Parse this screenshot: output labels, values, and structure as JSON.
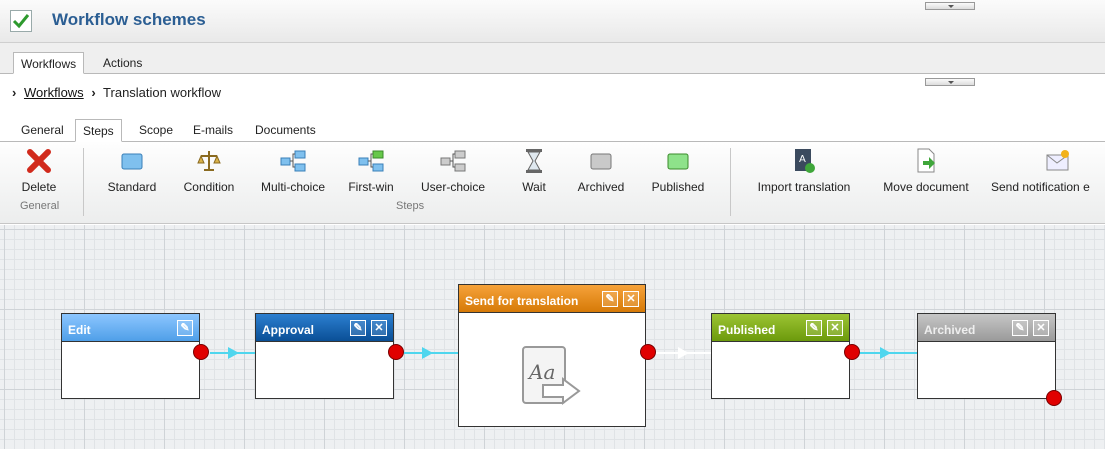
{
  "header": {
    "title": "Workflow schemes"
  },
  "main_tabs": [
    {
      "label": "Workflows",
      "active": true
    },
    {
      "label": "Actions",
      "active": false
    }
  ],
  "breadcrumb": {
    "link": "Workflows",
    "current": "Translation workflow"
  },
  "sub_tabs": [
    {
      "label": "General",
      "active": false
    },
    {
      "label": "Steps",
      "active": true
    },
    {
      "label": "Scope",
      "active": false
    },
    {
      "label": "E-mails",
      "active": false
    },
    {
      "label": "Documents",
      "active": false
    }
  ],
  "ribbon": {
    "general": {
      "group_label": "General",
      "delete_label": "Delete"
    },
    "steps": {
      "group_label": "Steps",
      "items": [
        "Standard",
        "Condition",
        "Multi-choice",
        "First-win",
        "User-choice",
        "Wait",
        "Archived",
        "Published"
      ]
    },
    "actions": [
      "Import translation",
      "Move document",
      "Send notification e"
    ]
  },
  "workflow_nodes": [
    {
      "label": "Edit",
      "color": "#5aa7f0"
    },
    {
      "label": "Approval",
      "color": "#0f5fb0"
    },
    {
      "label": "Send for translation",
      "color": "#e9880f"
    },
    {
      "label": "Published",
      "color": "#7fa714"
    },
    {
      "label": "Archived",
      "color": "#9c9c9c"
    }
  ],
  "colors": {
    "connector_cyan": "#4fd6ee",
    "connector_white": "#ffffff",
    "port": "#e00000"
  }
}
